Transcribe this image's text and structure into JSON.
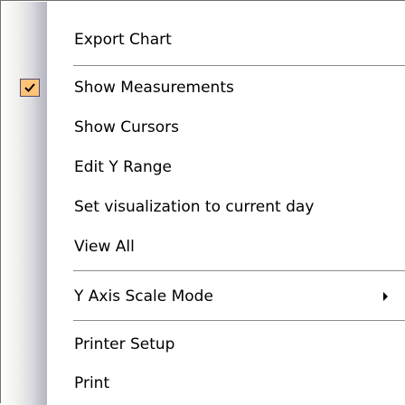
{
  "menu": {
    "items": [
      {
        "label": "Export Chart"
      },
      {
        "label": "Show Measurements",
        "checked": true
      },
      {
        "label": "Show Cursors"
      },
      {
        "label": "Edit Y Range"
      },
      {
        "label": "Set visualization to current day"
      },
      {
        "label": "View All"
      },
      {
        "label": "Y Axis Scale Mode",
        "has_submenu": true
      },
      {
        "label": "Printer Setup"
      },
      {
        "label": "Print"
      }
    ],
    "icons": {
      "check": "check-icon",
      "submenu": "submenu-arrow-icon"
    },
    "colors": {
      "check_highlight": "#ffc378",
      "gutter_dark": "#b7b7c3",
      "separator": "#8c8c8c"
    }
  }
}
